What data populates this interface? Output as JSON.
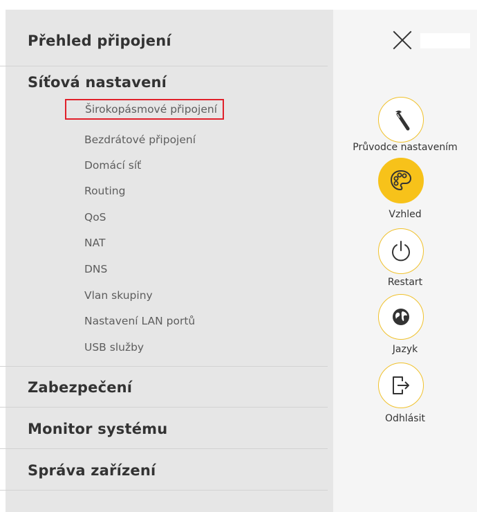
{
  "menu": {
    "sections": [
      {
        "label": "Přehled připojení"
      },
      {
        "label": "Síťová nastavení",
        "items": [
          "Širokopásmové připojení",
          "Bezdrátové připojení",
          "Domácí síť",
          "Routing",
          "QoS",
          "NAT",
          "DNS",
          "Vlan skupiny",
          "Nastavení LAN portů",
          "USB služby"
        ],
        "selected_item": "Širokopásmové připojení"
      },
      {
        "label": "Zabezpečení"
      },
      {
        "label": "Monitor systému"
      },
      {
        "label": "Správa zařízení"
      }
    ]
  },
  "side_actions": [
    {
      "label": "Průvodce nastavením",
      "icon": "wand-icon"
    },
    {
      "label": "Vzhled",
      "icon": "palette-icon"
    },
    {
      "label": "Restart",
      "icon": "power-icon"
    },
    {
      "label": "Jazyk",
      "icon": "globe-icon"
    },
    {
      "label": "Odhlásit",
      "icon": "logout-icon"
    }
  ],
  "colors": {
    "accent": "#f7c21a",
    "selection_outline": "#e0202a",
    "menu_background": "#e6e6e6",
    "side_background": "#f5f5f5"
  }
}
